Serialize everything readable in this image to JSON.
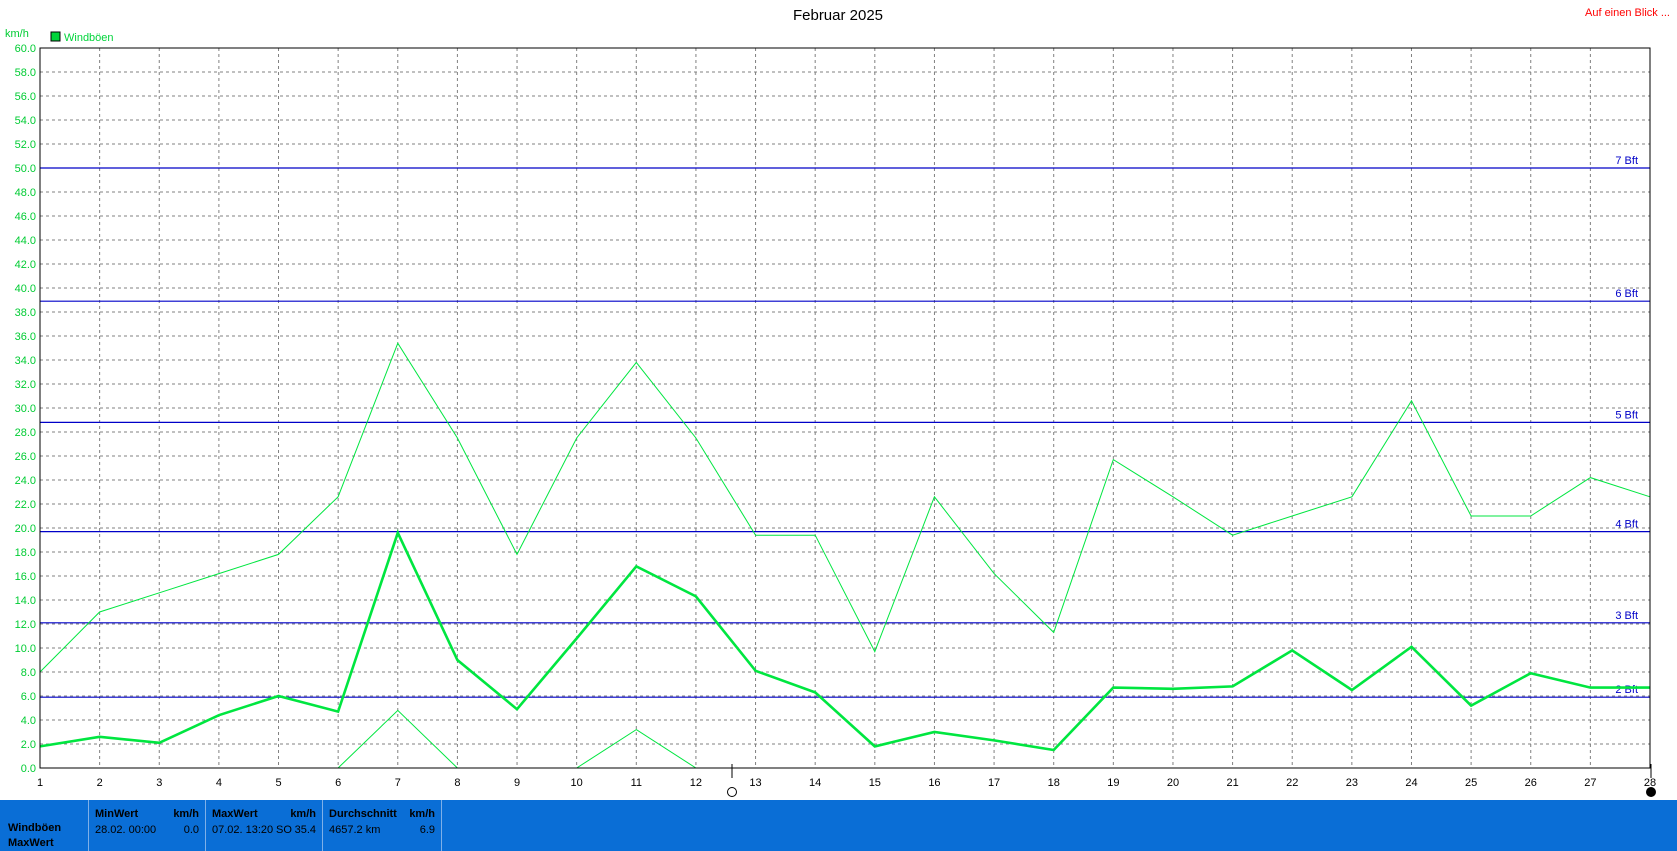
{
  "title": "Februar 2025",
  "top_link": "Auf einen Blick ...",
  "unit_label": "km/h",
  "legend": {
    "label": "Windböen",
    "color": "#00d43a"
  },
  "colors": {
    "series": "#00e640",
    "series_light": "#00e640",
    "bft_line": "#0000c8",
    "grid": "#808080",
    "axis_text": "#00cc33",
    "footer_bg": "#0a6ed6"
  },
  "chart_data": {
    "type": "line",
    "title": "Februar 2025",
    "ylabel": "km/h",
    "ylim": [
      0,
      60
    ],
    "yticks": [
      "0.0",
      "2.0",
      "4.0",
      "6.0",
      "8.0",
      "10.0",
      "12.0",
      "14.0",
      "16.0",
      "18.0",
      "20.0",
      "22.0",
      "24.0",
      "26.0",
      "28.0",
      "30.0",
      "32.0",
      "34.0",
      "36.0",
      "38.0",
      "40.0",
      "42.0",
      "44.0",
      "46.0",
      "48.0",
      "50.0",
      "52.0",
      "54.0",
      "56.0",
      "58.0",
      "60.0"
    ],
    "x": [
      1,
      2,
      3,
      4,
      5,
      6,
      7,
      8,
      9,
      10,
      11,
      12,
      13,
      14,
      15,
      16,
      17,
      18,
      19,
      20,
      21,
      22,
      23,
      24,
      25,
      26,
      27,
      28
    ],
    "series": [
      {
        "name": "Windböen",
        "role": "mean",
        "values": [
          1.8,
          2.6,
          2.1,
          4.4,
          6.0,
          4.7,
          19.6,
          9.0,
          4.9,
          10.8,
          16.8,
          14.3,
          8.1,
          6.3,
          1.8,
          3.0,
          2.3,
          1.5,
          6.7,
          6.6,
          6.8,
          9.8,
          6.5,
          10.1,
          5.2,
          7.9,
          6.7,
          6.7
        ]
      },
      {
        "role": "max",
        "values": [
          8.0,
          13.0,
          14.6,
          16.2,
          17.8,
          22.6,
          35.4,
          27.5,
          17.8,
          27.5,
          33.8,
          27.5,
          19.4,
          19.4,
          9.7,
          22.6,
          16.2,
          11.3,
          25.7,
          22.6,
          19.4,
          21.0,
          22.6,
          30.6,
          21.0,
          21.0,
          24.2,
          22.6
        ]
      },
      {
        "role": "min",
        "values": [
          null,
          null,
          null,
          null,
          null,
          0.0,
          4.8,
          0.0,
          null,
          0.0,
          3.2,
          0.0,
          null,
          null,
          null,
          null,
          null,
          null,
          null,
          null,
          null,
          null,
          null,
          null,
          null,
          null,
          null,
          null
        ]
      }
    ],
    "beaufort_lines": [
      {
        "label": "2 Bft",
        "value": 5.9
      },
      {
        "label": "3 Bft",
        "value": 12.1
      },
      {
        "label": "4 Bft",
        "value": 19.7
      },
      {
        "label": "5 Bft",
        "value": 28.8
      },
      {
        "label": "6 Bft",
        "value": 38.9
      },
      {
        "label": "7 Bft",
        "value": 50.0
      }
    ],
    "grid": true,
    "legend_position": "top-left"
  },
  "footer": {
    "row_labels": [
      "Windböen",
      "MaxWert"
    ],
    "panels": [
      {
        "header": "MinWert",
        "unit": "km/h",
        "date": "28.02.  00:00",
        "value": "0.0"
      },
      {
        "header": "MaxWert",
        "unit": "km/h",
        "date": "07.02.  13:20",
        "dir": "SO",
        "value": "35.4"
      },
      {
        "header": "Durchschnitt",
        "unit": "km/h",
        "date": "4657.2 km",
        "value": "6.9"
      }
    ]
  }
}
